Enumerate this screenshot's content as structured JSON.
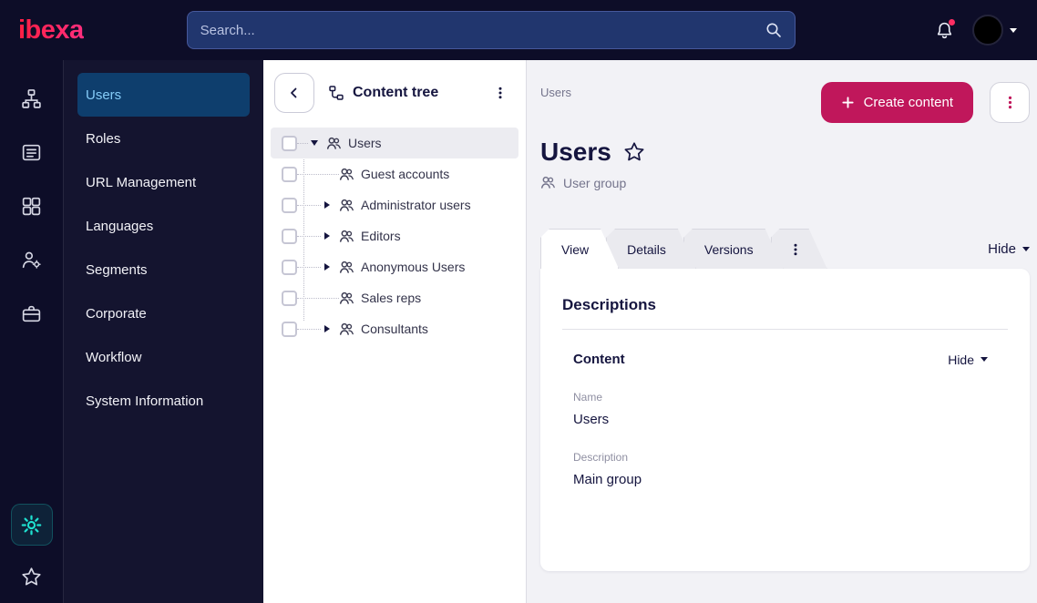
{
  "colors": {
    "logo_gradient_start": "#ff1f43",
    "logo_gradient_end": "#ff2e7e",
    "accent_pink": "#c0175b",
    "accent_teal": "#1fe0cf",
    "notification_red": "#ff2e63",
    "topbar_bg": "#0d0d28",
    "sidebar_bg": "#14142f",
    "search_bg": "#21366e",
    "search_border": "#46589b",
    "active_nav_bg": "#0e3e6d",
    "active_nav_text": "#85ccf8",
    "main_bg": "#f2f2f6",
    "text_dark": "#15153f",
    "text_muted": "#74748c",
    "border_light": "#dcdce4"
  },
  "topbar": {
    "logo_text": "ibexa",
    "search": {
      "placeholder": "Search...",
      "icon": "search-icon"
    },
    "notifications": {
      "icon": "bell-icon",
      "has_unread": true
    },
    "user_menu": {
      "icon": "avatar",
      "caret_icon": "chevron-down-icon"
    }
  },
  "icon_rail": {
    "top_icons": [
      "sitemap-icon",
      "content-list-icon",
      "blocks-icon",
      "audience-icon",
      "briefcase-icon"
    ],
    "bottom_icons": [
      "settings-gear-icon",
      "star-icon"
    ],
    "active_icon": "settings-gear-icon"
  },
  "sidebar": {
    "items": [
      {
        "label": "Users",
        "active": true
      },
      {
        "label": "Roles",
        "active": false
      },
      {
        "label": "URL Management",
        "active": false
      },
      {
        "label": "Languages",
        "active": false
      },
      {
        "label": "Segments",
        "active": false
      },
      {
        "label": "Corporate",
        "active": false
      },
      {
        "label": "Workflow",
        "active": false
      },
      {
        "label": "System Information",
        "active": false
      }
    ]
  },
  "content_tree": {
    "title": "Content tree",
    "collapse_icon": "chevron-left-icon",
    "menu_icon": "kebab-icon",
    "nodes": [
      {
        "label": "Users",
        "level": 0,
        "state": "expanded",
        "selected": true,
        "icon": "user-group-icon"
      },
      {
        "label": "Guest accounts",
        "level": 1,
        "state": "leaf",
        "selected": false,
        "icon": "user-group-icon"
      },
      {
        "label": "Administrator users",
        "level": 1,
        "state": "collapsed",
        "selected": false,
        "icon": "user-group-icon"
      },
      {
        "label": "Editors",
        "level": 1,
        "state": "collapsed",
        "selected": false,
        "icon": "user-group-icon"
      },
      {
        "label": "Anonymous Users",
        "level": 1,
        "state": "collapsed",
        "selected": false,
        "icon": "user-group-icon"
      },
      {
        "label": "Sales reps",
        "level": 1,
        "state": "leaf",
        "selected": false,
        "icon": "user-group-icon"
      },
      {
        "label": "Consultants",
        "level": 1,
        "state": "collapsed",
        "selected": false,
        "icon": "user-group-icon"
      }
    ]
  },
  "main": {
    "breadcrumb": "Users",
    "create_button_label": "Create content",
    "context_menu_icon": "kebab-icon",
    "page_title": "Users",
    "favorite_icon": "star-outline-icon",
    "content_type": {
      "icon": "user-group-icon",
      "label": "User group"
    },
    "tabs": [
      {
        "label": "View",
        "active": true
      },
      {
        "label": "Details",
        "active": false
      },
      {
        "label": "Versions",
        "active": false
      }
    ],
    "tabs_more_icon": "kebab-icon",
    "hide_toggle": "Hide",
    "card": {
      "heading": "Descriptions",
      "section": {
        "title": "Content",
        "hide_toggle": "Hide",
        "fields": [
          {
            "label": "Name",
            "value": "Users"
          },
          {
            "label": "Description",
            "value": "Main group"
          }
        ]
      }
    }
  }
}
